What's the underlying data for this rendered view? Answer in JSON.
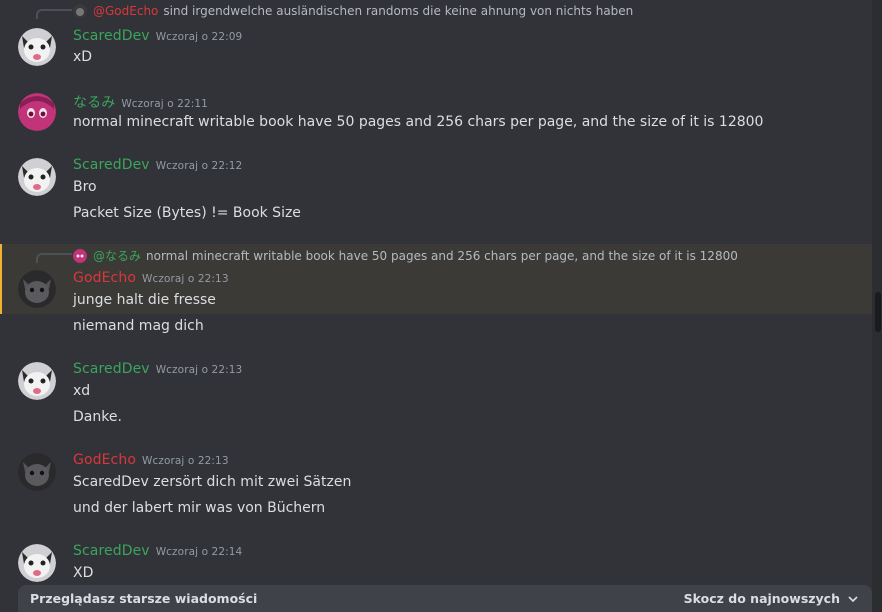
{
  "colors": {
    "green_user": "#3ba55c",
    "red_user": "#da373c",
    "pink_user": "#3ba55c",
    "highlight": "#f0b232"
  },
  "messages": [
    {
      "reply": {
        "name": "@GodEcho",
        "text": "sind irgendwelche ausländischen randoms die keine ahnung von nichts haben"
      }
    },
    {
      "author": "ScaredDev",
      "time": "Wczoraj o 22:09",
      "lines": [
        "xD"
      ],
      "avatar": "cat-icon"
    },
    {
      "author": "なるみ",
      "time": "Wczoraj o 22:11",
      "lines": [
        "normal minecraft writable book have 50 pages and 256 chars per page, and the size of it is 12800"
      ],
      "avatar": "anime-icon"
    },
    {
      "author": "ScaredDev",
      "time": "Wczoraj o 22:12",
      "lines": [
        "Bro",
        "Packet Size (Bytes) != Book Size"
      ],
      "avatar": "cat-icon"
    },
    {
      "reply": {
        "name": "@なるみ",
        "text": "normal minecraft writable book have 50 pages and 256 chars per page, and the size of it is 12800"
      },
      "author": "GodEcho",
      "time": "Wczoraj o 22:13",
      "lines": [
        "junge halt die fresse",
        "niemand mag dich"
      ],
      "avatar": "dark-cat-icon"
    },
    {
      "author": "ScaredDev",
      "time": "Wczoraj o 22:13",
      "lines": [
        "xd",
        "Danke."
      ],
      "avatar": "cat-icon"
    },
    {
      "author": "GodEcho",
      "time": "Wczoraj o 22:13",
      "lines": [
        "ScaredDev zersört dich mit zwei Sätzen",
        "und der labert mir was von Büchern"
      ],
      "avatar": "dark-cat-icon"
    },
    {
      "author": "ScaredDev",
      "time": "Wczoraj o 22:14",
      "lines": [
        "XD"
      ],
      "avatar": "cat-icon"
    }
  ],
  "bottom_bar": {
    "left": "Przeglądasz starsze wiadomości",
    "right": "Skocz do najnowszych"
  }
}
